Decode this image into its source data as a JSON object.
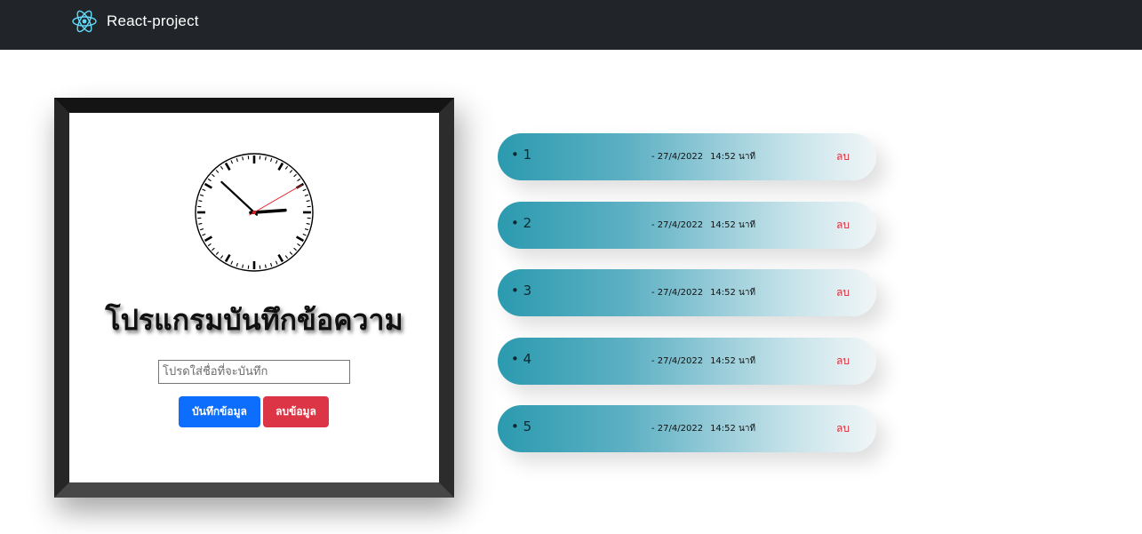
{
  "navbar": {
    "brand_icon": "react-logo-icon",
    "brand_text": "React-project"
  },
  "card": {
    "clock": {
      "hour": 14,
      "minute": 52,
      "second": 10
    },
    "title": "โปรแกรมบันทึกข้อความ",
    "input_placeholder": "โปรดใส่ชื่อที่จะบันทึก",
    "input_value": "",
    "save_button": "บันทึกข้อมูล",
    "clear_button": "ลบข้อมูล",
    "colors": {
      "save": "#0d6efd",
      "clear": "#dc3545"
    }
  },
  "notes": [
    {
      "name": "• 1",
      "date": "- 27/4/2022",
      "time": "14:52 นาที",
      "delete_label": "ลบ"
    },
    {
      "name": "• 2",
      "date": "- 27/4/2022",
      "time": "14:52 นาที",
      "delete_label": "ลบ"
    },
    {
      "name": "• 3",
      "date": "- 27/4/2022",
      "time": "14:52 นาที",
      "delete_label": "ลบ"
    },
    {
      "name": "• 4",
      "date": "- 27/4/2022",
      "time": "14:52 นาที",
      "delete_label": "ลบ"
    },
    {
      "name": "• 5",
      "date": "- 27/4/2022",
      "time": "14:52 นาที",
      "delete_label": "ลบ"
    }
  ]
}
